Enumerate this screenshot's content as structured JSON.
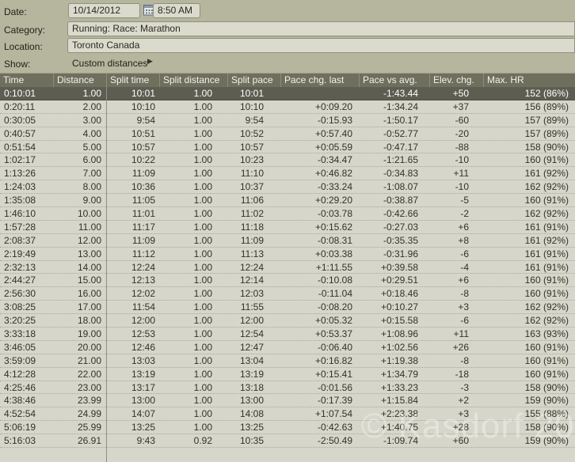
{
  "form": {
    "date": {
      "label": "Date:",
      "value": "10/14/2012",
      "time_value": "8:50 AM"
    },
    "category": {
      "label": "Category:",
      "value": "Running: Race: Marathon"
    },
    "location": {
      "label": "Location:",
      "value": "Toronto Canada"
    },
    "show": {
      "label": "Show:",
      "value": "Custom distances",
      "arrow_glyph": "▶"
    }
  },
  "table": {
    "columns": [
      "Time",
      "Distance",
      "Split time",
      "Split distance",
      "Split pace",
      "Pace chg. last",
      "Pace vs avg.",
      "Elev. chg.",
      "Max. HR"
    ],
    "selected_row_index": 0,
    "rows": [
      [
        "0:10:01",
        "1.00",
        "10:01",
        "1.00",
        "10:01",
        "",
        "-1:43.44",
        "+50",
        "152 (86%)"
      ],
      [
        "0:20:11",
        "2.00",
        "10:10",
        "1.00",
        "10:10",
        "+0:09.20",
        "-1:34.24",
        "+37",
        "156 (89%)"
      ],
      [
        "0:30:05",
        "3.00",
        "9:54",
        "1.00",
        "9:54",
        "-0:15.93",
        "-1:50.17",
        "-60",
        "157 (89%)"
      ],
      [
        "0:40:57",
        "4.00",
        "10:51",
        "1.00",
        "10:52",
        "+0:57.40",
        "-0:52.77",
        "-20",
        "157 (89%)"
      ],
      [
        "0:51:54",
        "5.00",
        "10:57",
        "1.00",
        "10:57",
        "+0:05.59",
        "-0:47.17",
        "-88",
        "158 (90%)"
      ],
      [
        "1:02:17",
        "6.00",
        "10:22",
        "1.00",
        "10:23",
        "-0:34.47",
        "-1:21.65",
        "-10",
        "160 (91%)"
      ],
      [
        "1:13:26",
        "7.00",
        "11:09",
        "1.00",
        "11:10",
        "+0:46.82",
        "-0:34.83",
        "+11",
        "161 (92%)"
      ],
      [
        "1:24:03",
        "8.00",
        "10:36",
        "1.00",
        "10:37",
        "-0:33.24",
        "-1:08.07",
        "-10",
        "162 (92%)"
      ],
      [
        "1:35:08",
        "9.00",
        "11:05",
        "1.00",
        "11:06",
        "+0:29.20",
        "-0:38.87",
        "-5",
        "160 (91%)"
      ],
      [
        "1:46:10",
        "10.00",
        "11:01",
        "1.00",
        "11:02",
        "-0:03.78",
        "-0:42.66",
        "-2",
        "162 (92%)"
      ],
      [
        "1:57:28",
        "11.00",
        "11:17",
        "1.00",
        "11:18",
        "+0:15.62",
        "-0:27.03",
        "+6",
        "161 (91%)"
      ],
      [
        "2:08:37",
        "12.00",
        "11:09",
        "1.00",
        "11:09",
        "-0:08.31",
        "-0:35.35",
        "+8",
        "161 (92%)"
      ],
      [
        "2:19:49",
        "13.00",
        "11:12",
        "1.00",
        "11:13",
        "+0:03.38",
        "-0:31.96",
        "-6",
        "161 (91%)"
      ],
      [
        "2:32:13",
        "14.00",
        "12:24",
        "1.00",
        "12:24",
        "+1:11.55",
        "+0:39.58",
        "-4",
        "161 (91%)"
      ],
      [
        "2:44:27",
        "15.00",
        "12:13",
        "1.00",
        "12:14",
        "-0:10.08",
        "+0:29.51",
        "+6",
        "160 (91%)"
      ],
      [
        "2:56:30",
        "16.00",
        "12:02",
        "1.00",
        "12:03",
        "-0:11.04",
        "+0:18.46",
        "-8",
        "160 (91%)"
      ],
      [
        "3:08:25",
        "17.00",
        "11:54",
        "1.00",
        "11:55",
        "-0:08.20",
        "+0:10.27",
        "+3",
        "162 (92%)"
      ],
      [
        "3:20:25",
        "18.00",
        "12:00",
        "1.00",
        "12:00",
        "+0:05.32",
        "+0:15.58",
        "-6",
        "162 (92%)"
      ],
      [
        "3:33:18",
        "19.00",
        "12:53",
        "1.00",
        "12:54",
        "+0:53.37",
        "+1:08.96",
        "+11",
        "163 (93%)"
      ],
      [
        "3:46:05",
        "20.00",
        "12:46",
        "1.00",
        "12:47",
        "-0:06.40",
        "+1:02.56",
        "+26",
        "160 (91%)"
      ],
      [
        "3:59:09",
        "21.00",
        "13:03",
        "1.00",
        "13:04",
        "+0:16.82",
        "+1:19.38",
        "-8",
        "160 (91%)"
      ],
      [
        "4:12:28",
        "22.00",
        "13:19",
        "1.00",
        "13:19",
        "+0:15.41",
        "+1:34.79",
        "-18",
        "160 (91%)"
      ],
      [
        "4:25:46",
        "23.00",
        "13:17",
        "1.00",
        "13:18",
        "-0:01.56",
        "+1:33.23",
        "-3",
        "158 (90%)"
      ],
      [
        "4:38:46",
        "23.99",
        "13:00",
        "1.00",
        "13:00",
        "-0:17.39",
        "+1:15.84",
        "+2",
        "159 (90%)"
      ],
      [
        "4:52:54",
        "24.99",
        "14:07",
        "1.00",
        "14:08",
        "+1:07.54",
        "+2:23.38",
        "+3",
        "155 (88%)"
      ],
      [
        "5:06:19",
        "25.99",
        "13:25",
        "1.00",
        "13:25",
        "-0:42.63",
        "+1:40.75",
        "+28",
        "158 (90%)"
      ],
      [
        "5:16:03",
        "26.91",
        "9:43",
        "0.92",
        "10:35",
        "-2:50.49",
        "-1:09.74",
        "+60",
        "159 (90%)"
      ]
    ]
  },
  "watermark": {
    "text": "© Kasdorf 2012"
  },
  "colors": {
    "form_bg": "#b6b69e",
    "field_bg": "#dadacd",
    "header_bg": "#6f6f5e",
    "selected_row_bg": "#5d5d52",
    "row_bg": "#d6d6ca"
  }
}
